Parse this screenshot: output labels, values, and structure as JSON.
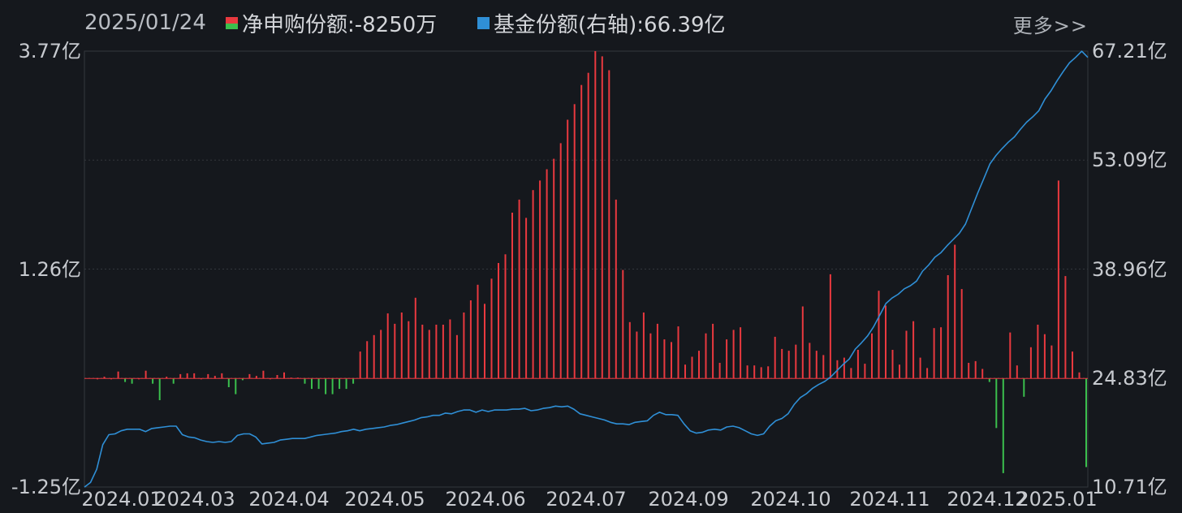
{
  "header": {
    "date": "2025/01/24",
    "flow_label": "净申购份额:-8250万",
    "share_label": "基金份额(右轴):66.39亿",
    "more_label": "更多>>"
  },
  "colors": {
    "inflow": "#e9393f",
    "outflow": "#3bbf4d",
    "share_line": "#2f8fd6",
    "background": "#15181d",
    "grid": "#33373d",
    "text": "#c7cacf"
  },
  "chart_data": {
    "type": "bar+line",
    "left_axis": {
      "unit": "亿",
      "ticks": [
        "3.77亿",
        "1.26亿",
        "-1.25亿"
      ],
      "range": [
        -1.25,
        3.77
      ]
    },
    "right_axis": {
      "unit": "亿",
      "ticks": [
        "67.21亿",
        "53.09亿",
        "38.96亿",
        "24.83亿",
        "10.71亿"
      ],
      "range": [
        10.71,
        67.21
      ]
    },
    "x_tick_labels": [
      "2024.01",
      "2024.03",
      "2024.04",
      "2024.05",
      "2024.06",
      "2024.07",
      "2024.09",
      "2024.10",
      "2024.11",
      "2024.12",
      "2025.01"
    ],
    "series": [
      {
        "name": "净申购份额",
        "type": "bar",
        "values": [
          0.0,
          0.02,
          0.0,
          0.08,
          -0.04,
          -0.06,
          0.0,
          0.09,
          -0.06,
          -0.25,
          0.02,
          -0.06,
          0.05,
          0.06,
          0.06,
          0.0,
          0.05,
          0.03,
          0.06,
          -0.1,
          -0.18,
          -0.02,
          0.05,
          0.03,
          0.09,
          0.0,
          0.04,
          0.07,
          0.01,
          0.01,
          -0.06,
          -0.12,
          -0.12,
          -0.18,
          -0.18,
          -0.12,
          -0.12,
          -0.06,
          0.31,
          0.43,
          0.5,
          0.56,
          0.75,
          0.63,
          0.76,
          0.66,
          0.93,
          0.62,
          0.56,
          0.62,
          0.62,
          0.68,
          0.5,
          0.76,
          0.9,
          1.08,
          0.86,
          1.15,
          1.33,
          1.43,
          1.91,
          2.06,
          1.85,
          2.17,
          2.28,
          2.41,
          2.53,
          2.71,
          2.98,
          3.16,
          3.38,
          3.52,
          3.77,
          3.71,
          3.55,
          2.06,
          1.25,
          0.65,
          0.54,
          0.76,
          0.52,
          0.63,
          0.45,
          0.42,
          0.6,
          0.16,
          0.25,
          0.32,
          0.52,
          0.63,
          0.18,
          0.45,
          0.56,
          0.59,
          0.15,
          0.15,
          0.13,
          0.14,
          0.48,
          0.34,
          0.32,
          0.39,
          0.83,
          0.41,
          0.32,
          0.27,
          1.2,
          0.21,
          0.24,
          0.12,
          0.33,
          0.17,
          0.52,
          1.01,
          0.84,
          0.33,
          0.16,
          0.55,
          0.66,
          0.24,
          0.12,
          0.58,
          0.59,
          1.19,
          1.54,
          1.03,
          0.18,
          0.2,
          0.11,
          -0.04,
          -0.57,
          -1.09,
          0.53,
          0.15,
          -0.21,
          0.36,
          0.62,
          0.51,
          0.38,
          2.28,
          1.18,
          0.31,
          0.07,
          -1.02
        ]
      },
      {
        "name": "基金份额",
        "type": "line",
        "axis": "right",
        "values": [
          10.7,
          11.3,
          13.0,
          16.2,
          17.5,
          17.6,
          18.0,
          18.2,
          18.2,
          18.2,
          17.9,
          18.3,
          18.4,
          18.5,
          18.6,
          18.6,
          17.5,
          17.2,
          17.1,
          16.8,
          16.6,
          16.5,
          16.6,
          16.5,
          16.6,
          17.4,
          17.6,
          17.6,
          17.2,
          16.3,
          16.4,
          16.5,
          16.8,
          16.9,
          17.0,
          17.0,
          17.0,
          17.2,
          17.4,
          17.5,
          17.6,
          17.7,
          17.9,
          18.0,
          18.2,
          18.0,
          18.2,
          18.3,
          18.4,
          18.5,
          18.7,
          18.8,
          19.0,
          19.2,
          19.4,
          19.7,
          19.8,
          20.0,
          20.0,
          20.3,
          20.2,
          20.5,
          20.7,
          20.7,
          20.4,
          20.7,
          20.5,
          20.7,
          20.7,
          20.7,
          20.8,
          20.8,
          20.9,
          20.6,
          20.7,
          20.9,
          21.0,
          21.2,
          21.1,
          21.2,
          20.8,
          20.2,
          20.0,
          19.8,
          19.6,
          19.4,
          19.1,
          18.9,
          18.9,
          18.8,
          19.1,
          19.2,
          19.3,
          20.0,
          20.4,
          20.1,
          20.1,
          20.0,
          18.9,
          18.0,
          17.7,
          17.8,
          18.1,
          18.2,
          18.1,
          18.5,
          18.6,
          18.4,
          18.0,
          17.6,
          17.4,
          17.6,
          18.6,
          19.3,
          19.6,
          20.2,
          21.4,
          22.3,
          22.8,
          23.5,
          24.0,
          24.4,
          25.0,
          25.8,
          26.6,
          27.3,
          28.6,
          29.4,
          30.3,
          31.5,
          33.0,
          34.5,
          35.2,
          35.7,
          36.4,
          36.8,
          37.4,
          38.7,
          39.5,
          40.5,
          41.1,
          42.0,
          42.8,
          43.6,
          44.8,
          46.8,
          48.8,
          50.7,
          52.6,
          53.7,
          54.6,
          55.4,
          56.1,
          57.1,
          58.0,
          58.7,
          59.5,
          61.0,
          62.1,
          63.4,
          64.6,
          65.7,
          66.4,
          67.2,
          66.4
        ]
      }
    ],
    "grid": true
  }
}
